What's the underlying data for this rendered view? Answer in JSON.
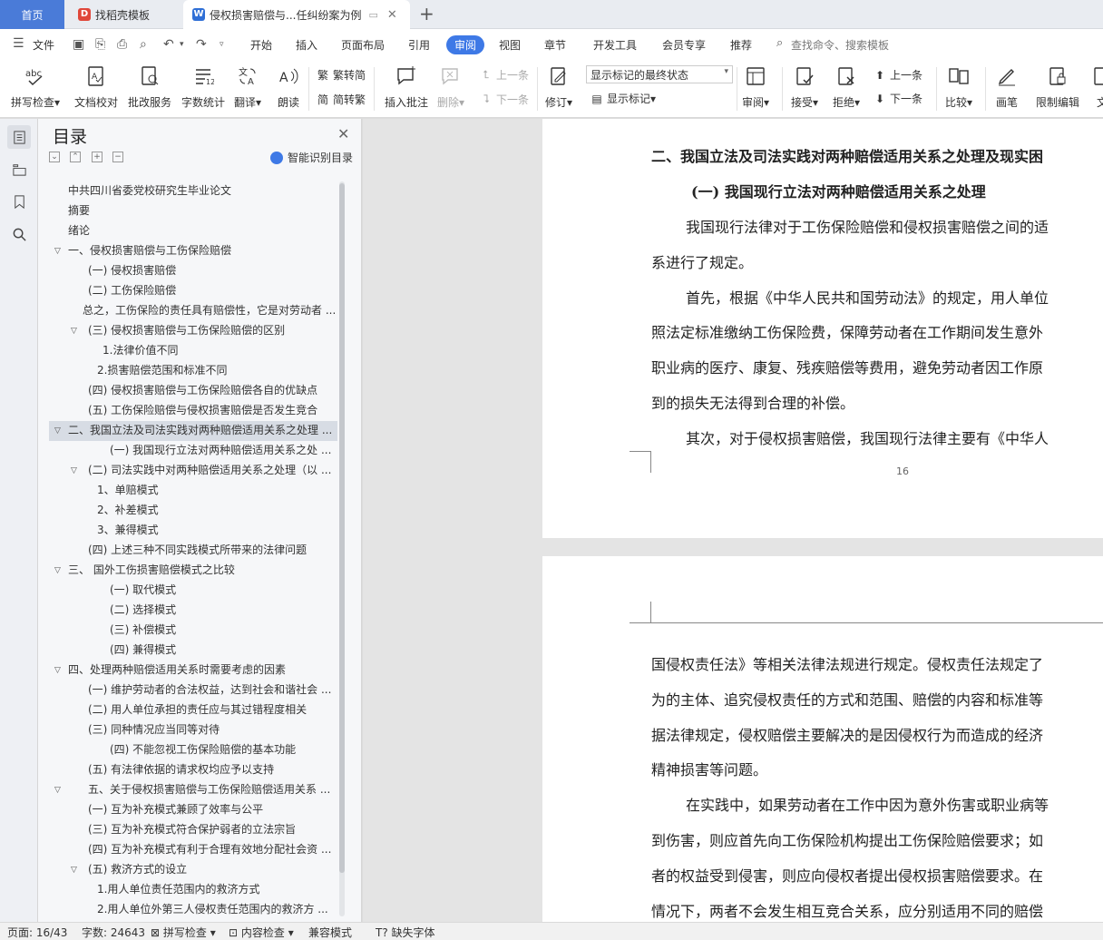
{
  "tabs": [
    {
      "label": "首页"
    },
    {
      "label": "找稻壳模板"
    },
    {
      "label": "侵权损害赔偿与...任纠纷案为例"
    }
  ],
  "menu": {
    "file": "文件",
    "items": [
      "开始",
      "插入",
      "页面布局",
      "引用",
      "审阅",
      "视图",
      "章节",
      "开发工具",
      "会员专享",
      "推荐"
    ],
    "active": "审阅",
    "search": "查找命令、搜索模板"
  },
  "ribbon": {
    "spell": "拼写检查",
    "proof": "文档校对",
    "batch": "批改服务",
    "count": "字数统计",
    "translate": "翻译",
    "read": "朗读",
    "trad": "繁转简",
    "simp": "简转繁",
    "insert_comment": "插入批注",
    "delete": "删除",
    "prev_comment": "上一条",
    "next_comment": "下一条",
    "revise": "修订",
    "markup_state": "显示标记的最终状态",
    "show_markup": "显示标记",
    "review": "审阅",
    "accept": "接受",
    "reject": "拒绝",
    "prev": "上一条",
    "next": "下一条",
    "compare": "比较",
    "pen": "画笔",
    "restrict": "限制编辑",
    "doc": "文"
  },
  "toc": {
    "title": "目录",
    "smart": "智能识别目录",
    "items": [
      {
        "text": "中共四川省委党校研究生毕业论文"
      },
      {
        "text": "摘要"
      },
      {
        "text": "绪论"
      },
      {
        "text": "一、侵权损害赔偿与工伤保险赔偿"
      },
      {
        "text": "(一) 侵权损害赔偿"
      },
      {
        "text": "(二) 工伤保险赔偿"
      },
      {
        "text": "总之，工伤保险的责任具有赔偿性，它是对劳动者 ..."
      },
      {
        "text": "(三) 侵权损害赔偿与工伤保险赔偿的区别"
      },
      {
        "text": "1.法律价值不同"
      },
      {
        "text": "2.损害赔偿范围和标准不同"
      },
      {
        "text": "(四) 侵权损害赔偿与工伤保险赔偿各自的优缺点"
      },
      {
        "text": "(五) 工伤保险赔偿与侵权损害赔偿是否发生竞合"
      },
      {
        "text": "二、我国立法及司法实践对两种赔偿适用关系之处理 ..."
      },
      {
        "text": "(一) 我国现行立法对两种赔偿适用关系之处 ..."
      },
      {
        "text": "(二) 司法实践中对两种赔偿适用关系之处理（以 ..."
      },
      {
        "text": "1、单赔模式"
      },
      {
        "text": "2、补差模式"
      },
      {
        "text": "3、兼得模式"
      },
      {
        "text": "(四) 上述三种不同实践模式所带来的法律问题"
      },
      {
        "text": "三、 国外工伤损害赔偿模式之比较"
      },
      {
        "text": "(一) 取代模式"
      },
      {
        "text": "(二) 选择模式"
      },
      {
        "text": "(三) 补偿模式"
      },
      {
        "text": "(四) 兼得模式"
      },
      {
        "text": "四、处理两种赔偿适用关系时需要考虑的因素"
      },
      {
        "text": "(一) 维护劳动者的合法权益，达到社会和谐社会 ..."
      },
      {
        "text": "(二) 用人单位承担的责任应与其过错程度相关"
      },
      {
        "text": "(三) 同种情况应当同等对待"
      },
      {
        "text": "(四) 不能忽视工伤保险赔偿的基本功能"
      },
      {
        "text": "(五) 有法律依据的请求权均应予以支持"
      },
      {
        "text": "五、关于侵权损害赔偿与工伤保险赔偿适用关系 ..."
      },
      {
        "text": "(一) 互为补充模式兼顾了效率与公平"
      },
      {
        "text": "(三) 互为补充模式符合保护弱者的立法宗旨"
      },
      {
        "text": "(四) 互为补充模式有利于合理有效地分配社会资 ..."
      },
      {
        "text": "(五) 救济方式的设立"
      },
      {
        "text": "1.用人单位责任范围内的救济方式"
      },
      {
        "text": "2.用人单位外第三人侵权责任范围内的救济方 ..."
      }
    ]
  },
  "page1": {
    "heading": "二、我国立法及司法实践对两种赔偿适用关系之处理及现实困",
    "subheading": "(一) 我国现行立法对两种赔偿适用关系之处理",
    "lines": [
      "我国现行法律对于工伤保险赔偿和侵权损害赔偿之间的适",
      "系进行了规定。",
      "首先，根据《中华人民共和国劳动法》的规定，用人单位",
      "照法定标准缴纳工伤保险费，保障劳动者在工作期间发生意外",
      "职业病的医疗、康复、残疾赔偿等费用，避免劳动者因工作原",
      "到的损失无法得到合理的补偿。",
      "其次，对于侵权损害赔偿，我国现行法律主要有《中华人"
    ],
    "page_number": "16"
  },
  "page2": {
    "lines": [
      "国侵权责任法》等相关法律法规进行规定。侵权责任法规定了",
      "为的主体、追究侵权责任的方式和范围、赔偿的内容和标准等",
      "据法律规定，侵权赔偿主要解决的是因侵权行为而造成的经济",
      "精神损害等问题。",
      "在实践中，如果劳动者在工作中因为意外伤害或职业病等",
      "到伤害，则应首先向工伤保险机构提出工伤保险赔偿要求；如",
      "者的权益受到侵害，则应向侵权者提出侵权损害赔偿要求。在",
      "情况下，两者不会发生相互竞合关系，应分别适用不同的赔偿"
    ]
  },
  "status": {
    "page": "页面: 16/43",
    "words": "字数: 24643",
    "spell": "拼写检查",
    "content": "内容检查",
    "compat": "兼容模式",
    "font": "缺失字体"
  }
}
